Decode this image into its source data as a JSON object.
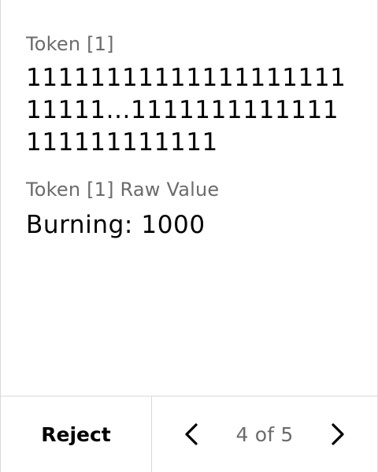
{
  "fields": [
    {
      "label": "Token [1]",
      "value": "1111111111111111111111111...1111111111111111111111111"
    },
    {
      "label": "Token [1] Raw Value",
      "value": "Burning: 1000"
    }
  ],
  "footer": {
    "reject_label": "Reject",
    "page_indicator": "4 of 5",
    "prev_icon": "chevron-left-icon",
    "next_icon": "chevron-right-icon"
  },
  "colors": {
    "background": "#ffffff",
    "label_text": "#6b6b6b",
    "value_text": "#000000",
    "divider": "#d9d9d9"
  }
}
